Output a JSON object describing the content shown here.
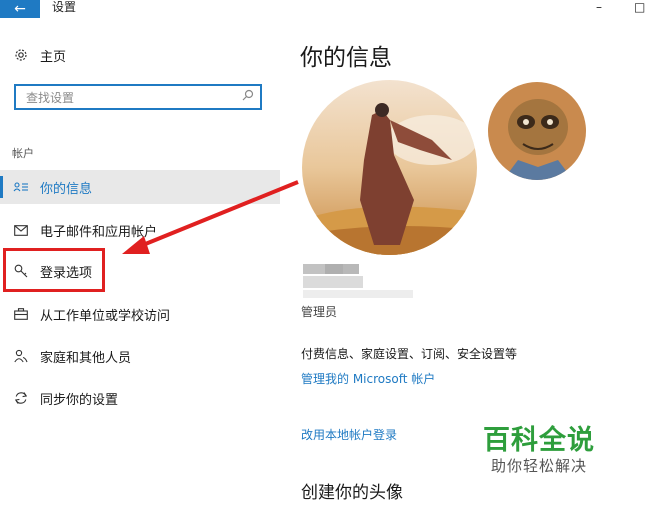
{
  "titlebar": {
    "back_glyph": "←",
    "title": "设置",
    "minimize_glyph": "–",
    "maximize_glyph": "□"
  },
  "sidebar": {
    "home": {
      "label": "主页",
      "icon": "gear-icon"
    },
    "search": {
      "placeholder": "查找设置",
      "icon": "search-icon"
    },
    "section_label": "帐户",
    "items": [
      {
        "label": "你的信息",
        "icon": "person-card-icon",
        "selected": true
      },
      {
        "label": "电子邮件和应用帐户",
        "icon": "mail-icon"
      },
      {
        "label": "登录选项",
        "icon": "key-icon"
      },
      {
        "label": "从工作单位或学校访问",
        "icon": "briefcase-icon"
      },
      {
        "label": "家庭和其他人员",
        "icon": "people-icon"
      },
      {
        "label": "同步你的设置",
        "icon": "sync-icon"
      }
    ]
  },
  "main": {
    "title": "你的信息",
    "role": "管理员",
    "billing_info": "付费信息、家庭设置、订阅、安全设置等",
    "manage_link": "管理我的 Microsoft 帐户",
    "local_signin_link": "改用本地帐户登录",
    "create_avatar_heading": "创建你的头像"
  },
  "watermark": {
    "title": "百科全说",
    "subtitle": "助你轻松解决"
  },
  "colors": {
    "accent": "#1f7ac3",
    "highlight": "#e02020",
    "watermark_green": "#2e9e3c"
  }
}
